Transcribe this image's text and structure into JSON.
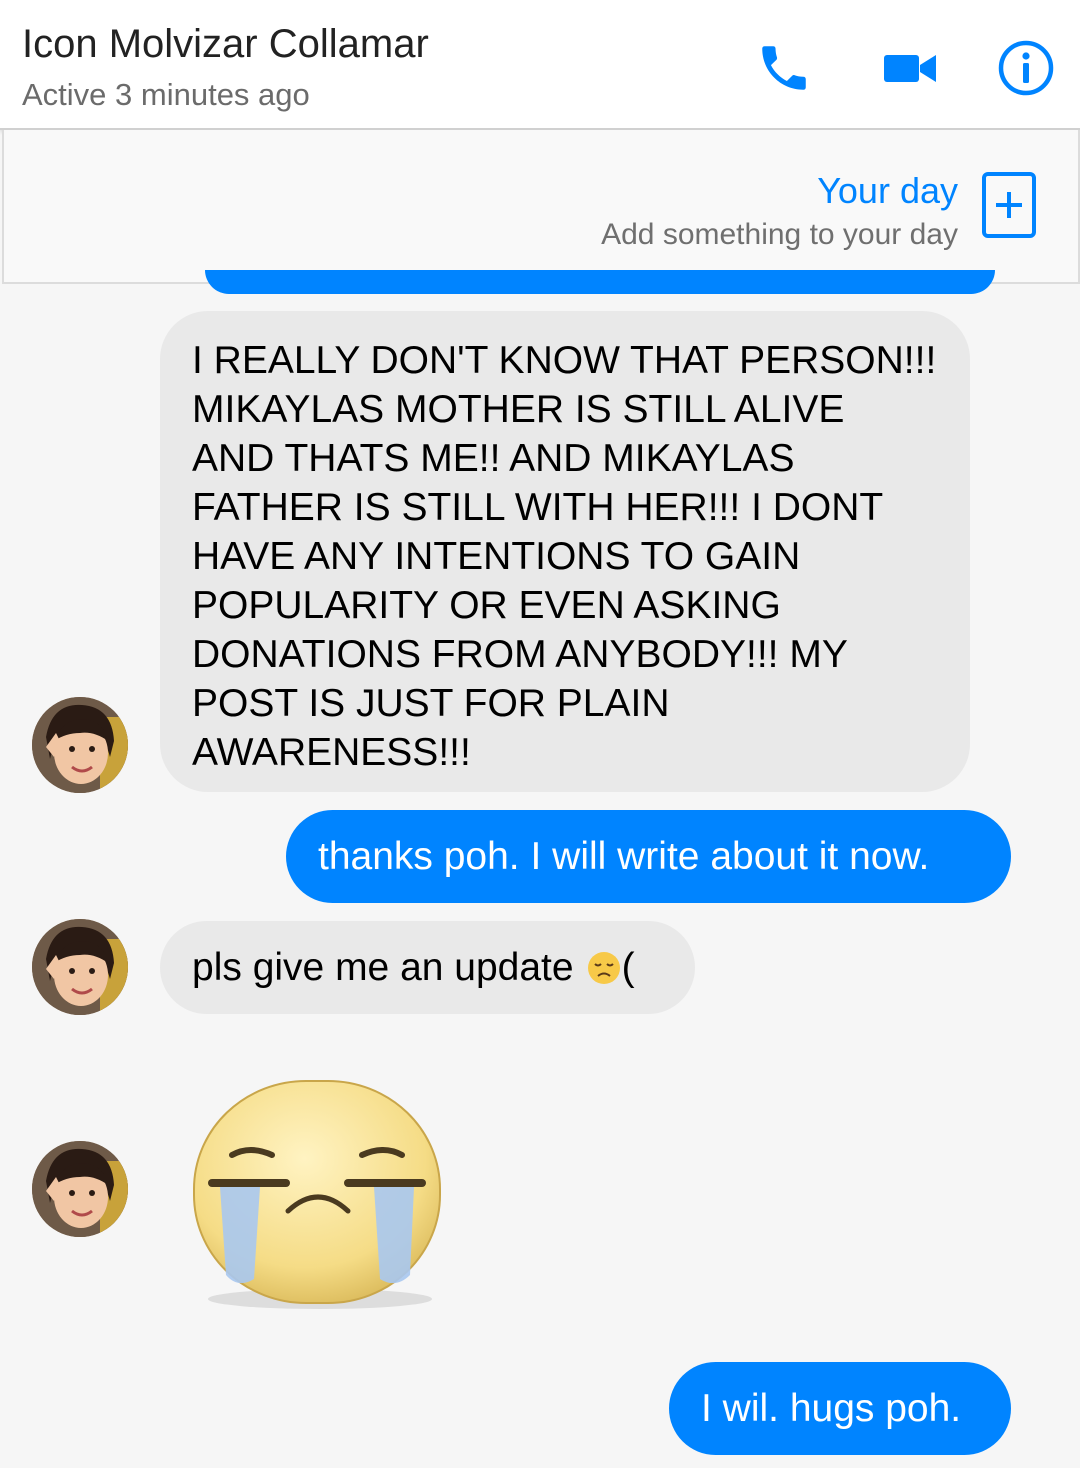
{
  "header": {
    "contact_name": "Icon Molvizar Collamar",
    "status": "Active 3 minutes ago",
    "icons": [
      "phone-icon",
      "video-camera-icon",
      "info-icon"
    ]
  },
  "story": {
    "title": "Your day",
    "subtitle": "Add something to your day",
    "add_icon": "plus-icon"
  },
  "messages": [
    {
      "from": "them",
      "lines": [
        "I REALLY DON'T KNOW THAT PERSON!!!",
        "MIKAYLAS MOTHER IS STILL ALIVE",
        "AND THATS ME!! AND MIKAYLAS",
        "FATHER IS STILL WITH HER!!! I DONT",
        "HAVE ANY INTENTIONS TO GAIN",
        "POPULARITY OR EVEN ASKING",
        "DONATIONS FROM ANYBODY!!! MY",
        "POST IS JUST FOR PLAIN",
        "AWARENESS!!!"
      ]
    },
    {
      "from": "me",
      "text": "thanks poh. I will write about it now."
    },
    {
      "from": "them",
      "text": "pls give me an update",
      "trailing_emoji": "disappointed-face-emoji",
      "after_emoji": "("
    },
    {
      "from": "them",
      "sticker": "crying-face-sticker"
    },
    {
      "from": "me",
      "text": "I wil. hugs poh."
    }
  ],
  "colors": {
    "accent": "#0084ff",
    "incoming_bubble": "#e9e9e9",
    "background": "#f6f6f6"
  }
}
